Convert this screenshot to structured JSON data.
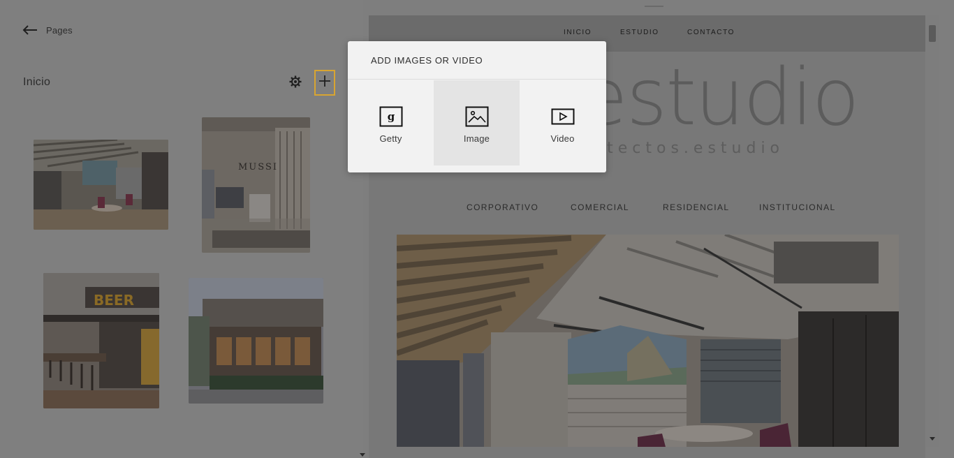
{
  "nav": {
    "back_label": "Pages"
  },
  "page": {
    "title": "Inicio"
  },
  "popup": {
    "title": "ADD IMAGES OR VIDEO",
    "options": [
      {
        "label": "Getty",
        "icon": "getty-icon"
      },
      {
        "label": "Image",
        "icon": "image-icon"
      },
      {
        "label": "Video",
        "icon": "video-icon"
      }
    ],
    "highlighted_option": "Image"
  },
  "preview": {
    "nav_links": [
      "INICIO",
      "ESTUDIO",
      "CONTACTO"
    ],
    "logo_text": "estudio",
    "logo_subtitle": "itectos.estudio",
    "categories": [
      "CORPORATIVO",
      "COMERCIAL",
      "RESIDENCIAL",
      "INSTITUCIONAL"
    ]
  },
  "thumbnails": [
    {
      "alt": "office-interior"
    },
    {
      "alt": "shoe-store",
      "sign": "MUSSI"
    },
    {
      "alt": "bar-restaurant",
      "sign": "BEER"
    },
    {
      "alt": "street-restaurant"
    }
  ],
  "colors": {
    "accent": "#d8a531",
    "overlay": "#7f7f7f",
    "popup_bg": "#f2f2f2"
  }
}
